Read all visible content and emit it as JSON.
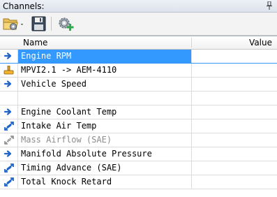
{
  "panel": {
    "title": "Channels:",
    "pin_icon": "pin-icon"
  },
  "toolbar": {
    "buttons": [
      {
        "icon": "open-folder-settings-icon"
      },
      {
        "icon": "save-disk-icon"
      },
      {
        "icon": "add-channel-gear-icon"
      }
    ]
  },
  "grid": {
    "columns": {
      "name": "Name",
      "value": "Value"
    },
    "rows": [
      {
        "name": "Engine RPM",
        "value": "",
        "icon": "arrow-right-icon",
        "selected": true
      },
      {
        "name": "MPVI2.1 -> AEM-4110",
        "value": "",
        "icon": "connector-plug-icon"
      },
      {
        "name": "Vehicle Speed",
        "value": "",
        "icon": "arrow-right-icon"
      },
      {
        "name": "",
        "value": "",
        "icon": ""
      },
      {
        "name": "Engine Coolant Temp",
        "value": "",
        "icon": "arrow-right-icon"
      },
      {
        "name": "Intake Air Temp",
        "value": "",
        "icon": "bidirectional-arrows-icon"
      },
      {
        "name": "Mass Airflow (SAE)",
        "value": "",
        "icon": "bidirectional-arrows-disabled-icon",
        "disabled": true
      },
      {
        "name": "Manifold Absolute Pressure",
        "value": "",
        "icon": "arrow-right-icon"
      },
      {
        "name": "Timing Advance (SAE)",
        "value": "",
        "icon": "bidirectional-arrows-icon"
      },
      {
        "name": "Total Knock Retard",
        "value": "",
        "icon": "bidirectional-arrows-icon"
      }
    ]
  },
  "colors": {
    "selection": "#3399ff",
    "arrow": "#1e64c8",
    "plug": "#e0a020"
  }
}
